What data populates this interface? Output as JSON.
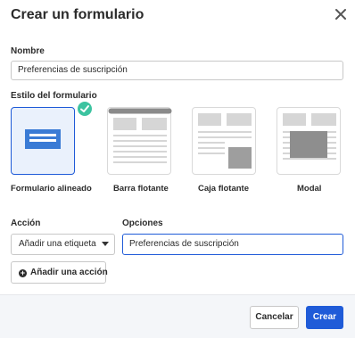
{
  "dialog": {
    "title": "Crear un formulario"
  },
  "name_field": {
    "label": "Nombre",
    "value": "Preferencias de suscripción"
  },
  "style_section": {
    "label": "Estilo del formulario",
    "selected": "Formulario alineado",
    "options": [
      {
        "label": "Formulario alineado",
        "icon": "inline-form-icon"
      },
      {
        "label": "Barra flotante",
        "icon": "floating-bar-icon"
      },
      {
        "label": "Caja flotante",
        "icon": "floating-box-icon"
      },
      {
        "label": "Modal",
        "icon": "modal-icon"
      }
    ]
  },
  "action_field": {
    "label": "Acción",
    "value": "Añadir una etiqueta"
  },
  "options_field": {
    "label": "Opciones",
    "value": "Preferencias de suscripción"
  },
  "add_action": {
    "label": "Añadir una acción"
  },
  "footer": {
    "cancel_label": "Cancelar",
    "create_label": "Crear"
  },
  "colors": {
    "primary": "#1f5bd8",
    "success": "#3cc3a0",
    "thumb_gray": "#d6d6d6"
  }
}
